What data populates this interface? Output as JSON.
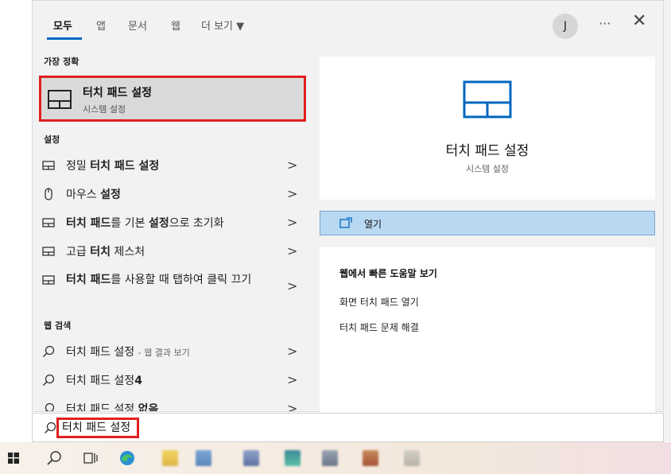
{
  "tabs": [
    {
      "label": "모두"
    },
    {
      "label": "앱"
    },
    {
      "label": "문서"
    },
    {
      "label": "웹"
    },
    {
      "label": "더 보기 ▼"
    }
  ],
  "header": {
    "avatar_initial": "J",
    "more_label": "···",
    "close_label": "✕"
  },
  "best_match": {
    "section": "가장 정확",
    "title": "터치 패드 설정",
    "subtitle": "시스템 설정"
  },
  "settings": {
    "section": "설정",
    "items": [
      {
        "text": "정밀 터치 패드 설정",
        "icon": "touchpad-icon"
      },
      {
        "text": "마우스 설정",
        "icon": "mouse-icon"
      },
      {
        "text": "터치 패드를 기본 설정으로 초기화",
        "icon": "touchpad-icon"
      },
      {
        "text": "고급 터치 제스처",
        "icon": "touchpad-icon"
      },
      {
        "text": "터치 패드를 사용할 때 탭하여 클릭 끄기",
        "icon": "touchpad-icon"
      }
    ]
  },
  "web_search": {
    "section": "웹 검색",
    "items": [
      {
        "text": "터치 패드 설정",
        "suffix": "- 웹 결과 보기"
      },
      {
        "text": "터치 패드 설정4"
      },
      {
        "text": "터치 패드 설정 없음"
      }
    ]
  },
  "chevron": ">",
  "detail": {
    "title": "터치 패드 설정",
    "subtitle": "시스템 설정",
    "open_label": "열기",
    "help_title": "웹에서 빠른 도움말 보기",
    "links": [
      "화면 터치 패드 열기",
      "터치 패드 문제 해결"
    ]
  },
  "search": {
    "value": "터치 패드 설정"
  },
  "colors": {
    "accent": "#0067c0",
    "highlight_border": "#e02020",
    "open_bar": "#b9d8f2"
  }
}
